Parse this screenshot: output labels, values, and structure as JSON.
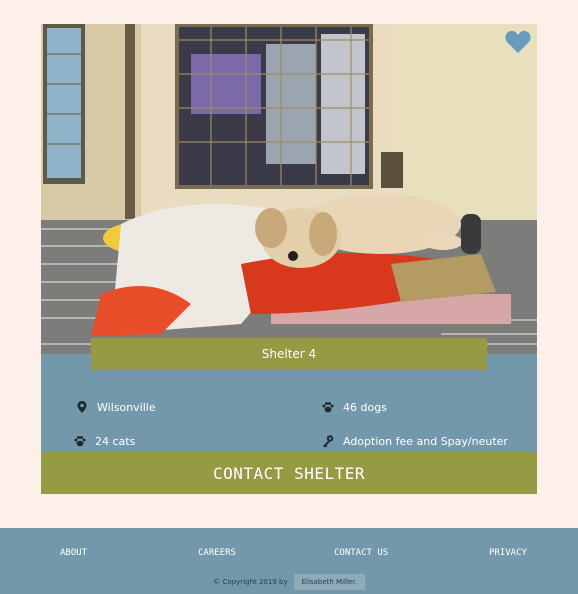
{
  "card": {
    "shelter_name": "Shelter 4",
    "location": "Wilsonville",
    "dogs": "46 dogs",
    "cats": "24 cats",
    "services": "Adoption fee and Spay/neuter",
    "contact_label": "CONTACT SHELTER",
    "icons": {
      "favorite": "heart-icon",
      "location": "map-pin-icon",
      "dogs": "paw-icon",
      "cats": "paw-icon",
      "services": "key-icon"
    }
  },
  "footer": {
    "links": [
      "ABOUT",
      "CAREERS",
      "CONTACT US",
      "PRIVACY"
    ],
    "copyright": "© Copyright 2019 by",
    "author": "Elisabeth Miller."
  },
  "colors": {
    "page_bg": "#fdf0ea",
    "card_blue": "#7398ab",
    "olive": "#969a42"
  }
}
